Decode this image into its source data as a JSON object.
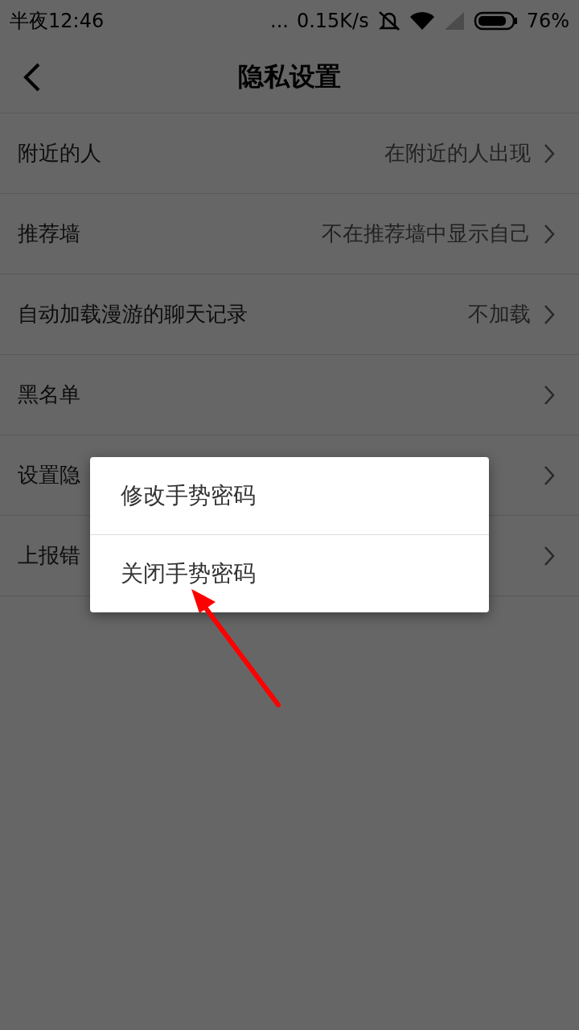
{
  "status_bar": {
    "time": "半夜12:46",
    "dots": "...",
    "speed": "0.15K/s",
    "battery": "76%"
  },
  "header": {
    "title": "隐私设置"
  },
  "rows": [
    {
      "label": "附近的人",
      "value": "在附近的人出现"
    },
    {
      "label": "推荐墙",
      "value": "不在推荐墙中显示自己"
    },
    {
      "label": "自动加载漫游的聊天记录",
      "value": "不加载"
    },
    {
      "label": "黑名单"
    },
    {
      "label": "设置隐"
    },
    {
      "label": "上报错"
    }
  ],
  "dialog": {
    "items": [
      "修改手势密码",
      "关闭手势密码"
    ]
  },
  "annotation": {
    "kind": "arrow"
  }
}
